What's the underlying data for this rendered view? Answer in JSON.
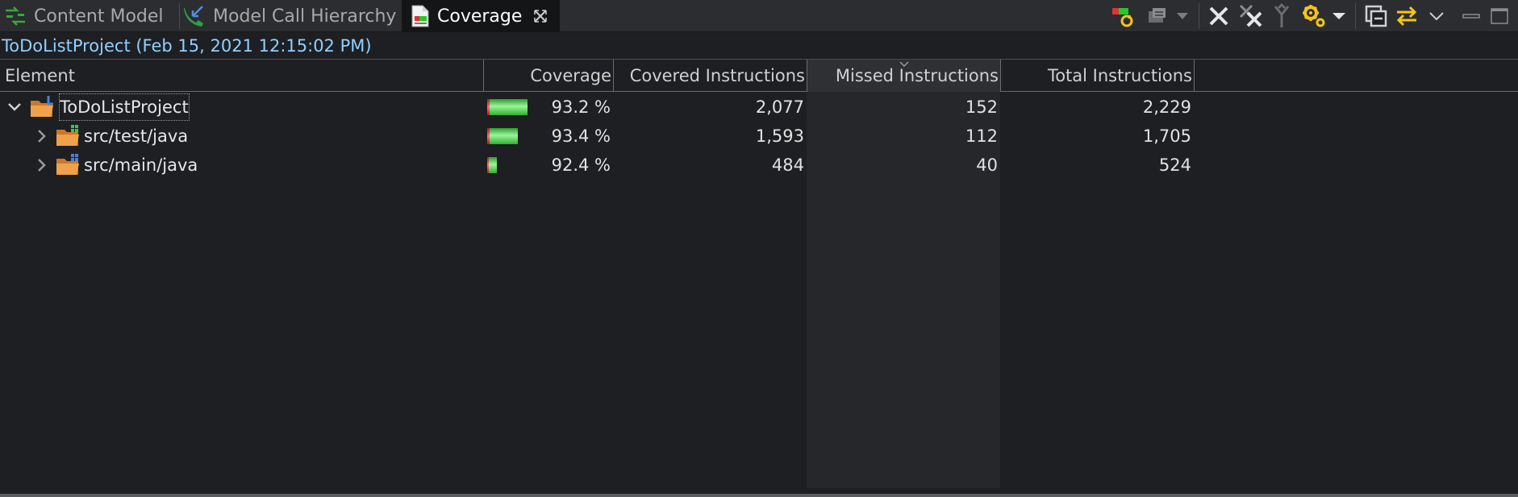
{
  "tabs": [
    {
      "label": "Content Model",
      "icon": "content-model-icon",
      "active": false
    },
    {
      "label": "Model Call Hierarchy",
      "icon": "call-hierarchy-icon",
      "active": false
    },
    {
      "label": "Coverage",
      "icon": "coverage-icon",
      "active": true,
      "close_icon": "close-tab-icon"
    }
  ],
  "toolbar": {
    "buttons": [
      "relaunch-coverage-icon",
      "dump-execution-data-icon",
      "dropdown-arrow-icon",
      "remove-session-icon",
      "remove-all-sessions-icon",
      "merge-sessions-icon",
      "select-session-icon",
      "collapse-all-icon",
      "link-with-selection-icon",
      "view-menu-icon",
      "minimize-icon",
      "maximize-icon"
    ]
  },
  "session": {
    "label": "ToDoListProject (Feb 15, 2021 12:15:02 PM)"
  },
  "table": {
    "columns": [
      {
        "label": "Element"
      },
      {
        "label": "Coverage"
      },
      {
        "label": "Covered Instructions"
      },
      {
        "label": "Missed Instructions",
        "sorted": true
      },
      {
        "label": "Total Instructions"
      }
    ],
    "rows": [
      {
        "name": "ToDoListProject",
        "coverage": "93.2 %",
        "covered": "2,077",
        "missed": "152",
        "total": "2,229",
        "coverage_ratio": 0.932,
        "expanded": true,
        "selected": true,
        "icon": "project-folder-icon"
      },
      {
        "name": "src/test/java",
        "coverage": "93.4 %",
        "covered": "1,593",
        "missed": "112",
        "total": "1,705",
        "coverage_ratio": 0.934,
        "expanded": false,
        "icon": "source-folder-icon"
      },
      {
        "name": "src/main/java",
        "coverage": "92.4 %",
        "covered": "484",
        "missed": "40",
        "total": "524",
        "coverage_ratio": 0.924,
        "expanded": false,
        "icon": "source-folder-icon"
      }
    ]
  },
  "colors": {
    "background": "#1e1f22",
    "session_text": "#8fd0ff",
    "covered_bar": "#3cc43c",
    "missed_bar": "#e03c3c",
    "accent_yellow": "#f5c518"
  }
}
